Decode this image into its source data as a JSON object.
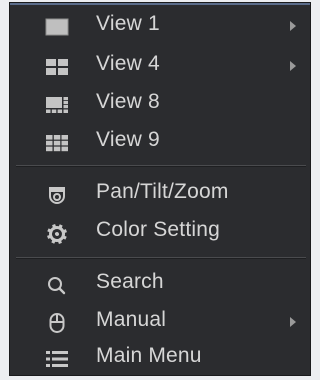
{
  "menu": {
    "items": [
      {
        "label": "View 1",
        "icon": "single-view-icon",
        "submenu": true
      },
      {
        "label": "View 4",
        "icon": "quad-view-icon",
        "submenu": true
      },
      {
        "label": "View 8",
        "icon": "eight-view-icon",
        "submenu": false
      },
      {
        "label": "View 9",
        "icon": "nine-view-icon",
        "submenu": false
      },
      {
        "label": "Pan/Tilt/Zoom",
        "icon": "ptz-camera-icon",
        "submenu": false
      },
      {
        "label": "Color Setting",
        "icon": "gear-icon",
        "submenu": false
      },
      {
        "label": "Search",
        "icon": "search-icon",
        "submenu": false
      },
      {
        "label": "Manual",
        "icon": "mouse-icon",
        "submenu": true
      },
      {
        "label": "Main Menu",
        "icon": "list-menu-icon",
        "submenu": false
      }
    ]
  },
  "colors": {
    "background": "#2b2c2f",
    "text": "#d6d6d6",
    "icon": "#c8c8c8",
    "separator": "#4a4b4e",
    "top_border": "#5a6c8a"
  }
}
